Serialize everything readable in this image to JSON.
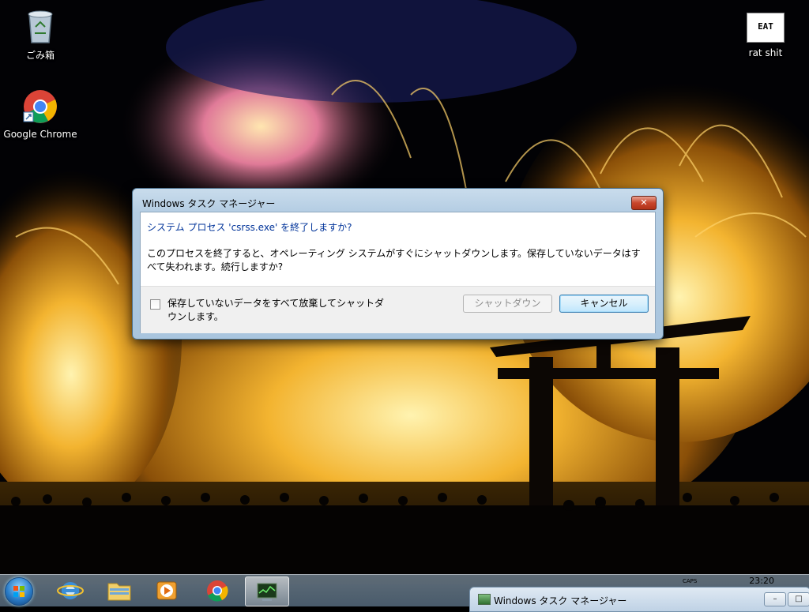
{
  "desktop": {
    "icons": [
      {
        "label": "ごみ箱",
        "icon": "recycle-bin-icon"
      },
      {
        "label": "Google Chrome",
        "icon": "chrome-icon"
      },
      {
        "label": "rat shit",
        "icon": "eat-shit-image-icon",
        "image_text": "EAT SHIT"
      }
    ]
  },
  "dialog": {
    "title": "Windows タスク マネージャー",
    "close_label": "✕",
    "main_instruction": "システム プロセス 'csrss.exe' を終了しますか?",
    "content": "このプロセスを終了すると、オペレーティング システムがすぐにシャットダウンします。保存していないデータはすべて失われます。続行しますか?",
    "checkbox_label": "保存していないデータをすべて放棄してシャットダウンします。",
    "checkbox_checked": false,
    "shutdown_button": "シャットダウン",
    "cancel_button": "キャンセル"
  },
  "taskbar": {
    "pinned": [
      {
        "name": "internet-explorer-icon"
      },
      {
        "name": "explorer-folder-icon"
      },
      {
        "name": "media-player-icon"
      },
      {
        "name": "chrome-icon"
      },
      {
        "name": "task-manager-icon",
        "active": true
      }
    ],
    "clock": "23:20",
    "tray_text": "CAPS"
  },
  "mini_window": {
    "title": "Windows タスク マネージャー"
  },
  "colors": {
    "instruction_blue": "#003399",
    "close_red": "#c8452c",
    "dialog_frame": "#b4cde3"
  }
}
